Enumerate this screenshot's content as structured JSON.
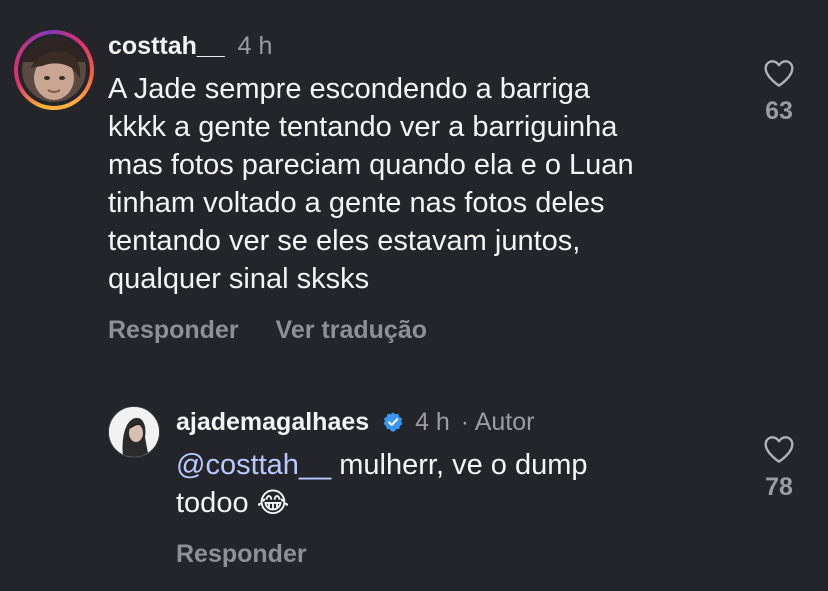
{
  "comment1": {
    "username": "costtah__",
    "time": "4 h",
    "lines": [
      "A Jade sempre escondendo a barriga",
      "kkkk a gente tentando ver a barriguinha",
      "mas fotos pareciam quando ela e o Luan",
      "tinham voltado a gente nas fotos deles",
      "tentando ver se eles estavam juntos,",
      "qualquer sinal sksks"
    ],
    "reply_label": "Responder",
    "translate_label": "Ver tradução",
    "likes": "63"
  },
  "comment2": {
    "username": "ajademagalhaes",
    "time": "4 h",
    "author_label": "· Autor",
    "mention": "@costtah__",
    "line1_rest": " mulherr, ve o dump",
    "line2": "todoo",
    "emoji": "😂",
    "reply_label": "Responder",
    "likes": "78"
  },
  "colors": {
    "background": "#24252b",
    "text": "#f4f4f4",
    "muted": "#9a9ca3",
    "mention": "#b7c9ff",
    "verified": "#3897f0"
  }
}
